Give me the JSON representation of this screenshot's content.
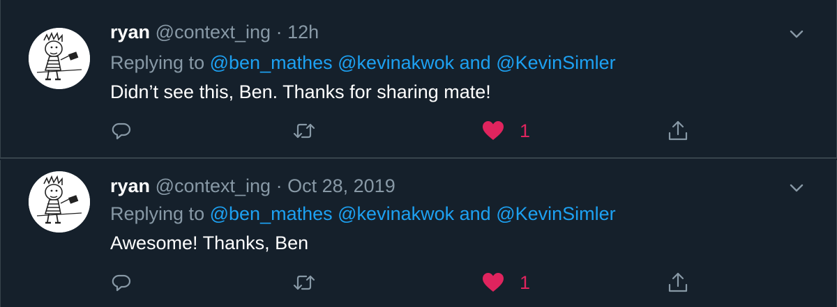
{
  "tweets": [
    {
      "name": "ryan",
      "handle": "@context_ing",
      "separator": "·",
      "time": "12h",
      "replying_prefix": "Replying to",
      "mentions": [
        "@ben_mathes",
        "@kevinakwok"
      ],
      "and_word": "and",
      "last_mention": "@KevinSimler",
      "text": "Didn’t see this, Ben. Thanks for sharing mate!",
      "like_count": "1",
      "liked": true
    },
    {
      "name": "ryan",
      "handle": "@context_ing",
      "separator": "·",
      "time": "Oct 28, 2019",
      "replying_prefix": "Replying to",
      "mentions": [
        "@ben_mathes",
        "@kevinakwok"
      ],
      "and_word": "and",
      "last_mention": "@KevinSimler",
      "text": "Awesome! Thanks, Ben",
      "like_count": "1",
      "liked": true
    }
  ],
  "icons": {
    "reply": "reply-icon",
    "retweet": "retweet-icon",
    "like": "heart-icon",
    "share": "share-icon",
    "more": "chevron-down-icon",
    "avatar": "avatar"
  },
  "colors": {
    "background": "#15202b",
    "border": "#38444d",
    "secondary_text": "#8899a6",
    "link": "#1da1f2",
    "like": "#e0245e"
  }
}
